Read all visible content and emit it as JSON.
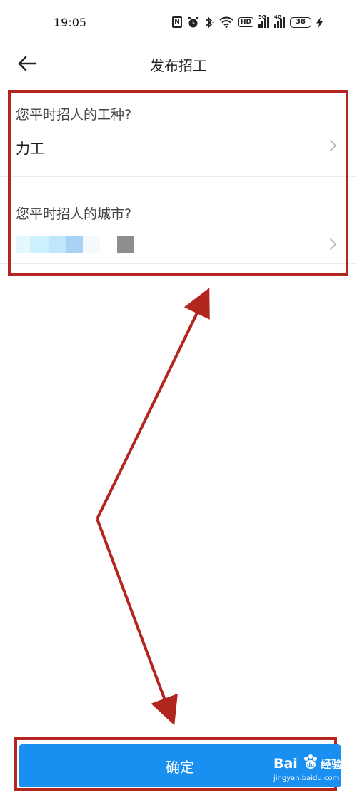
{
  "status_bar": {
    "time": "19:05",
    "icons": [
      "nfc-icon",
      "alarm-icon",
      "bluetooth-icon",
      "wifi-icon",
      "hd-icon",
      "signal-5g-icon",
      "signal-4g-icon",
      "battery-icon",
      "charging-icon"
    ],
    "hd_label": "HD",
    "sig1_label": "5G",
    "sig2_label": "4G",
    "nfc_label": "N",
    "battery_level": "38"
  },
  "header": {
    "title": "发布招工",
    "back_icon": "back-arrow-icon"
  },
  "form": {
    "rows": [
      {
        "question": "您平时招人的工种?",
        "value": "力工"
      },
      {
        "question": "您平时招人的城市?",
        "value": ""
      }
    ]
  },
  "confirm_label": "确定",
  "watermark": {
    "brand": "Bai",
    "brand_suffix": "du",
    "product": "经验",
    "url": "jingyan.baidu.com"
  },
  "colors": {
    "accent": "#1a8ff2",
    "annotation": "#b3251f"
  }
}
